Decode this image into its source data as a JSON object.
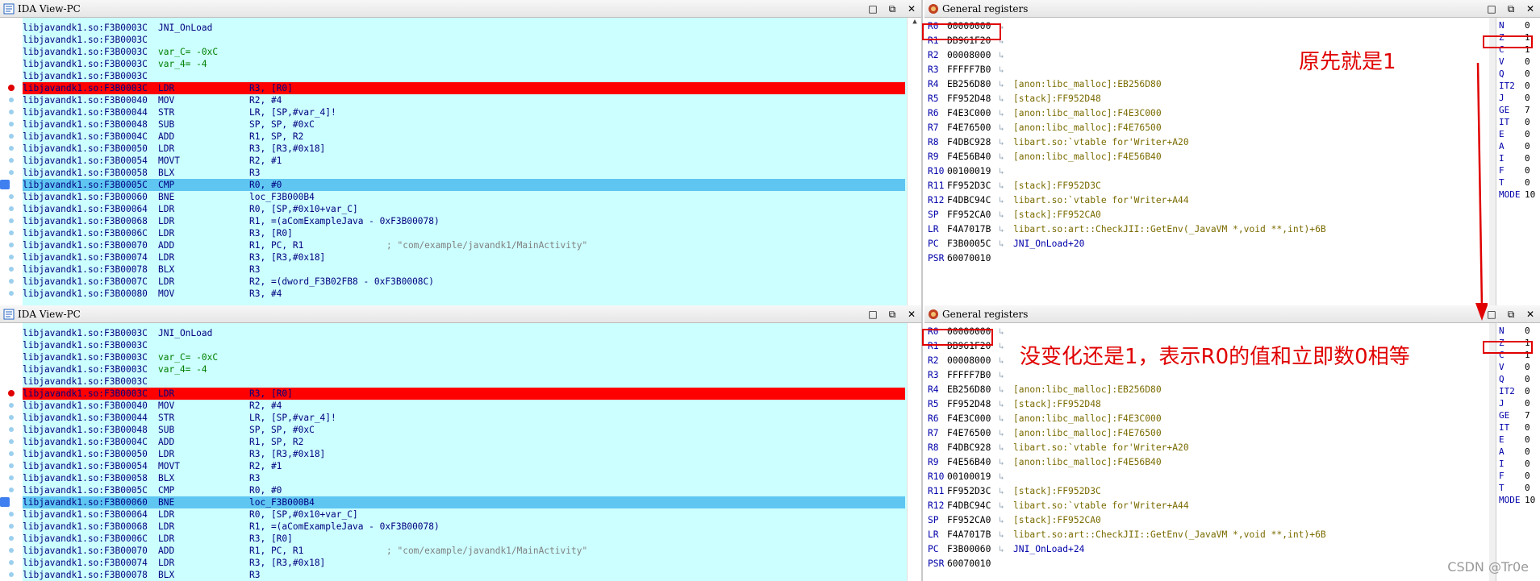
{
  "ida_title": "IDA View-PC",
  "regs_title": "General registers",
  "window_buttons": {
    "min": "□",
    "restore": "⧉",
    "close": "✕"
  },
  "top": {
    "code": [
      {
        "addr": "libjavandk1.so:F3B0003C",
        "mn": "JNI_OnLoad",
        "op": "",
        "cm": "",
        "state": ""
      },
      {
        "addr": "libjavandk1.so:F3B0003C",
        "mn": "",
        "op": "",
        "cm": "",
        "state": ""
      },
      {
        "addr": "libjavandk1.so:F3B0003C",
        "mn": "var_C= -0xC",
        "op": "",
        "cm": "",
        "state": "var"
      },
      {
        "addr": "libjavandk1.so:F3B0003C",
        "mn": "var_4= -4",
        "op": "",
        "cm": "",
        "state": "var"
      },
      {
        "addr": "libjavandk1.so:F3B0003C",
        "mn": "",
        "op": "",
        "cm": "",
        "state": ""
      },
      {
        "addr": "libjavandk1.so:F3B0003C",
        "mn": "LDR",
        "op": "R3, [R0]",
        "cm": "",
        "state": "bp"
      },
      {
        "addr": "libjavandk1.so:F3B00040",
        "mn": "MOV",
        "op": "R2, #4",
        "cm": "",
        "state": ""
      },
      {
        "addr": "libjavandk1.so:F3B00044",
        "mn": "STR",
        "op": "LR, [SP,#var_4]!",
        "cm": "",
        "state": ""
      },
      {
        "addr": "libjavandk1.so:F3B00048",
        "mn": "SUB",
        "op": "SP, SP, #0xC",
        "cm": "",
        "state": ""
      },
      {
        "addr": "libjavandk1.so:F3B0004C",
        "mn": "ADD",
        "op": "R1, SP, R2",
        "cm": "",
        "state": ""
      },
      {
        "addr": "libjavandk1.so:F3B00050",
        "mn": "LDR",
        "op": "R3, [R3,#0x18]",
        "cm": "",
        "state": ""
      },
      {
        "addr": "libjavandk1.so:F3B00054",
        "mn": "MOVT",
        "op": "R2, #1",
        "cm": "",
        "state": ""
      },
      {
        "addr": "libjavandk1.so:F3B00058",
        "mn": "BLX",
        "op": "R3",
        "cm": "",
        "state": ""
      },
      {
        "addr": "libjavandk1.so:F3B0005C",
        "mn": "CMP",
        "op": "R0, #0",
        "cm": "",
        "state": "cur"
      },
      {
        "addr": "libjavandk1.so:F3B00060",
        "mn": "BNE",
        "op": "loc_F3B000B4",
        "cm": "",
        "state": ""
      },
      {
        "addr": "libjavandk1.so:F3B00064",
        "mn": "LDR",
        "op": "R0, [SP,#0x10+var_C]",
        "cm": "",
        "state": ""
      },
      {
        "addr": "libjavandk1.so:F3B00068",
        "mn": "LDR",
        "op": "R1, =(aComExampleJava - 0xF3B00078)",
        "cm": "",
        "state": ""
      },
      {
        "addr": "libjavandk1.so:F3B0006C",
        "mn": "LDR",
        "op": "R3, [R0]",
        "cm": "",
        "state": ""
      },
      {
        "addr": "libjavandk1.so:F3B00070",
        "mn": "ADD",
        "op": "R1, PC, R1",
        "cm": "; \"com/example/javandk1/MainActivity\"",
        "state": ""
      },
      {
        "addr": "libjavandk1.so:F3B00074",
        "mn": "LDR",
        "op": "R3, [R3,#0x18]",
        "cm": "",
        "state": ""
      },
      {
        "addr": "libjavandk1.so:F3B00078",
        "mn": "BLX",
        "op": "R3",
        "cm": "",
        "state": ""
      },
      {
        "addr": "libjavandk1.so:F3B0007C",
        "mn": "LDR",
        "op": "R2, =(dword_F3B02FB8 - 0xF3B0008C)",
        "cm": "",
        "state": ""
      },
      {
        "addr": "libjavandk1.so:F3B00080",
        "mn": "MOV",
        "op": "R3, #4",
        "cm": "",
        "state": ""
      }
    ],
    "regs": [
      {
        "n": "R0",
        "v": "00000000",
        "d": ""
      },
      {
        "n": "R1",
        "v": "DB961F20",
        "d": ""
      },
      {
        "n": "R2",
        "v": "00008000",
        "d": ""
      },
      {
        "n": "R3",
        "v": "FFFFF7B0",
        "d": ""
      },
      {
        "n": "R4",
        "v": "EB256D80",
        "d": "[anon:libc_malloc]:EB256D80"
      },
      {
        "n": "R5",
        "v": "FF952D48",
        "d": "[stack]:FF952D48"
      },
      {
        "n": "R6",
        "v": "F4E3C000",
        "d": "[anon:libc_malloc]:F4E3C000"
      },
      {
        "n": "R7",
        "v": "F4E76500",
        "d": "[anon:libc_malloc]:F4E76500"
      },
      {
        "n": "R8",
        "v": "F4DBC928",
        "d": "libart.so:`vtable for'Writer+A20"
      },
      {
        "n": "R9",
        "v": "F4E56B40",
        "d": "[anon:libc_malloc]:F4E56B40"
      },
      {
        "n": "R10",
        "v": "00100019",
        "d": ""
      },
      {
        "n": "R11",
        "v": "FF952D3C",
        "d": "[stack]:FF952D3C"
      },
      {
        "n": "R12",
        "v": "F4DBC94C",
        "d": "libart.so:`vtable for'Writer+A44"
      },
      {
        "n": "SP",
        "v": "FF952CA0",
        "d": "[stack]:FF952CA0"
      },
      {
        "n": "LR",
        "v": "F4A7017B",
        "d": "libart.so:art::CheckJII::GetEnv(_JavaVM *,void **,int)+6B"
      },
      {
        "n": "PC",
        "v": "F3B0005C",
        "d": "JNI_OnLoad+20"
      },
      {
        "n": "PSR",
        "v": "60070010",
        "d": ""
      }
    ],
    "annotation": "原先就是1"
  },
  "bottom": {
    "code": [
      {
        "addr": "libjavandk1.so:F3B0003C",
        "mn": "JNI_OnLoad",
        "op": "",
        "cm": "",
        "state": ""
      },
      {
        "addr": "libjavandk1.so:F3B0003C",
        "mn": "",
        "op": "",
        "cm": "",
        "state": ""
      },
      {
        "addr": "libjavandk1.so:F3B0003C",
        "mn": "var_C= -0xC",
        "op": "",
        "cm": "",
        "state": "var"
      },
      {
        "addr": "libjavandk1.so:F3B0003C",
        "mn": "var_4= -4",
        "op": "",
        "cm": "",
        "state": "var"
      },
      {
        "addr": "libjavandk1.so:F3B0003C",
        "mn": "",
        "op": "",
        "cm": "",
        "state": ""
      },
      {
        "addr": "libjavandk1.so:F3B0003C",
        "mn": "LDR",
        "op": "R3, [R0]",
        "cm": "",
        "state": "bp"
      },
      {
        "addr": "libjavandk1.so:F3B00040",
        "mn": "MOV",
        "op": "R2, #4",
        "cm": "",
        "state": ""
      },
      {
        "addr": "libjavandk1.so:F3B00044",
        "mn": "STR",
        "op": "LR, [SP,#var_4]!",
        "cm": "",
        "state": ""
      },
      {
        "addr": "libjavandk1.so:F3B00048",
        "mn": "SUB",
        "op": "SP, SP, #0xC",
        "cm": "",
        "state": ""
      },
      {
        "addr": "libjavandk1.so:F3B0004C",
        "mn": "ADD",
        "op": "R1, SP, R2",
        "cm": "",
        "state": ""
      },
      {
        "addr": "libjavandk1.so:F3B00050",
        "mn": "LDR",
        "op": "R3, [R3,#0x18]",
        "cm": "",
        "state": ""
      },
      {
        "addr": "libjavandk1.so:F3B00054",
        "mn": "MOVT",
        "op": "R2, #1",
        "cm": "",
        "state": ""
      },
      {
        "addr": "libjavandk1.so:F3B00058",
        "mn": "BLX",
        "op": "R3",
        "cm": "",
        "state": ""
      },
      {
        "addr": "libjavandk1.so:F3B0005C",
        "mn": "CMP",
        "op": "R0, #0",
        "cm": "",
        "state": ""
      },
      {
        "addr": "libjavandk1.so:F3B00060",
        "mn": "BNE",
        "op": "loc_F3B000B4",
        "cm": "",
        "state": "cur"
      },
      {
        "addr": "libjavandk1.so:F3B00064",
        "mn": "LDR",
        "op": "R0, [SP,#0x10+var_C]",
        "cm": "",
        "state": ""
      },
      {
        "addr": "libjavandk1.so:F3B00068",
        "mn": "LDR",
        "op": "R1, =(aComExampleJava - 0xF3B00078)",
        "cm": "",
        "state": ""
      },
      {
        "addr": "libjavandk1.so:F3B0006C",
        "mn": "LDR",
        "op": "R3, [R0]",
        "cm": "",
        "state": ""
      },
      {
        "addr": "libjavandk1.so:F3B00070",
        "mn": "ADD",
        "op": "R1, PC, R1",
        "cm": "; \"com/example/javandk1/MainActivity\"",
        "state": ""
      },
      {
        "addr": "libjavandk1.so:F3B00074",
        "mn": "LDR",
        "op": "R3, [R3,#0x18]",
        "cm": "",
        "state": ""
      },
      {
        "addr": "libjavandk1.so:F3B00078",
        "mn": "BLX",
        "op": "R3",
        "cm": "",
        "state": ""
      }
    ],
    "regs": [
      {
        "n": "R0",
        "v": "00000000",
        "d": ""
      },
      {
        "n": "R1",
        "v": "DB961F20",
        "d": ""
      },
      {
        "n": "R2",
        "v": "00008000",
        "d": ""
      },
      {
        "n": "R3",
        "v": "FFFFF7B0",
        "d": ""
      },
      {
        "n": "R4",
        "v": "EB256D80",
        "d": "[anon:libc_malloc]:EB256D80"
      },
      {
        "n": "R5",
        "v": "FF952D48",
        "d": "[stack]:FF952D48"
      },
      {
        "n": "R6",
        "v": "F4E3C000",
        "d": "[anon:libc_malloc]:F4E3C000"
      },
      {
        "n": "R7",
        "v": "F4E76500",
        "d": "[anon:libc_malloc]:F4E76500"
      },
      {
        "n": "R8",
        "v": "F4DBC928",
        "d": "libart.so:`vtable for'Writer+A20"
      },
      {
        "n": "R9",
        "v": "F4E56B40",
        "d": "[anon:libc_malloc]:F4E56B40"
      },
      {
        "n": "R10",
        "v": "00100019",
        "d": ""
      },
      {
        "n": "R11",
        "v": "FF952D3C",
        "d": "[stack]:FF952D3C"
      },
      {
        "n": "R12",
        "v": "F4DBC94C",
        "d": "libart.so:`vtable for'Writer+A44"
      },
      {
        "n": "SP",
        "v": "FF952CA0",
        "d": "[stack]:FF952CA0"
      },
      {
        "n": "LR",
        "v": "F4A7017B",
        "d": "libart.so:art::CheckJII::GetEnv(_JavaVM *,void **,int)+6B"
      },
      {
        "n": "PC",
        "v": "F3B00060",
        "d": "JNI_OnLoad+24"
      },
      {
        "n": "PSR",
        "v": "60070010",
        "d": ""
      }
    ],
    "annotation": "没变化还是1，表示R0的值和立即数0相等"
  },
  "flags": [
    {
      "n": "N",
      "v": "0"
    },
    {
      "n": "Z",
      "v": "1"
    },
    {
      "n": "C",
      "v": "1"
    },
    {
      "n": "V",
      "v": "0"
    },
    {
      "n": "Q",
      "v": "0"
    },
    {
      "n": "IT2",
      "v": "0"
    },
    {
      "n": "J",
      "v": "0"
    },
    {
      "n": "GE",
      "v": "7"
    },
    {
      "n": "IT",
      "v": "0"
    },
    {
      "n": "E",
      "v": "0"
    },
    {
      "n": "A",
      "v": "0"
    },
    {
      "n": "I",
      "v": "0"
    },
    {
      "n": "F",
      "v": "0"
    },
    {
      "n": "T",
      "v": "0"
    },
    {
      "n": "MODE",
      "v": "10"
    }
  ],
  "watermark": "CSDN @Tr0e",
  "colors": {
    "code_bg": "#ccffff",
    "breakpoint_line": "#ff0000",
    "current_line": "#5fc6f2",
    "annotation": "#e00000"
  }
}
